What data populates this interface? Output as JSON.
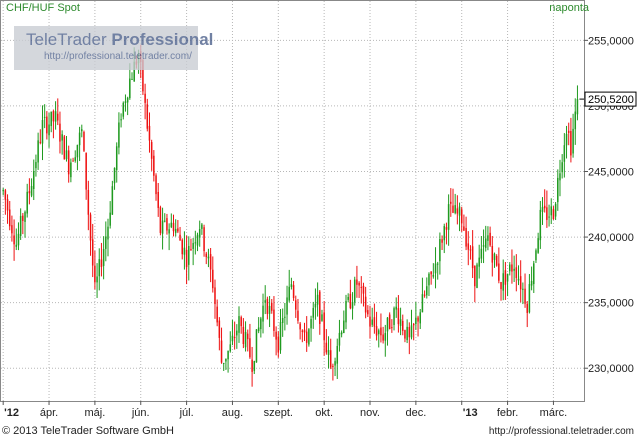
{
  "header": {
    "instrument": "CHF/HUF Spot",
    "interval": "naponta"
  },
  "logo": {
    "brand_plain": "TeleTrader ",
    "brand_bold": "Professional",
    "url": "http://professional.teletrader.com/"
  },
  "footer": {
    "copyright": "© 2013 TeleTrader Software GmbH",
    "url": "http://professional.teletrader.com"
  },
  "colors": {
    "up": "#1f9a1f",
    "down": "#ee1111",
    "grid": "#b7b7b7",
    "axis_text": "#222222"
  },
  "chart_data": {
    "type": "candlestick",
    "title": "CHF/HUF Spot",
    "interval": "naponta",
    "ylim": [
      227.5,
      258.0
    ],
    "y_ticks": [
      "230,0000",
      "235,0000",
      "240,0000",
      "245,0000",
      "250,0000",
      "255,0000"
    ],
    "y_tick_values": [
      230,
      235,
      240,
      245,
      250,
      255
    ],
    "last_price_label": "250,5200",
    "last_price": 250.52,
    "grid": true,
    "x_labels": [
      "'12",
      "ápr.",
      "máj.",
      "jún.",
      "júl.",
      "aug.",
      "szept.",
      "okt.",
      "nov.",
      "dec.",
      "'13",
      "febr.",
      "márc."
    ],
    "x_label_index": [
      0,
      21,
      42,
      63,
      84,
      105,
      126,
      147,
      168,
      189,
      210,
      231,
      252
    ],
    "x_range": [
      -1,
      266
    ],
    "trend_days": [
      0,
      6,
      12,
      18,
      24,
      30,
      36,
      42,
      48,
      54,
      58,
      62,
      66,
      72,
      78,
      84,
      90,
      96,
      100,
      104,
      108,
      114,
      120,
      126,
      132,
      138,
      144,
      150,
      156,
      162,
      168,
      174,
      180,
      186,
      192,
      198,
      204,
      210,
      216,
      222,
      228,
      234,
      240,
      246,
      252,
      256,
      258,
      260,
      263
    ],
    "trend_values": [
      243.5,
      239.5,
      243.5,
      248.5,
      249.0,
      245.5,
      248.0,
      235.8,
      241.0,
      249.5,
      252.0,
      254.0,
      248.5,
      240.5,
      241.0,
      238.5,
      241.0,
      236.5,
      230.5,
      231.5,
      233.5,
      230.5,
      235.5,
      232.0,
      236.5,
      232.0,
      235.0,
      230.0,
      234.0,
      236.5,
      233.5,
      232.5,
      234.5,
      232.0,
      235.0,
      238.0,
      242.0,
      241.5,
      237.0,
      240.0,
      236.5,
      238.0,
      235.0,
      241.5,
      242.0,
      246.5,
      248.5,
      247.0,
      250.52
    ]
  }
}
